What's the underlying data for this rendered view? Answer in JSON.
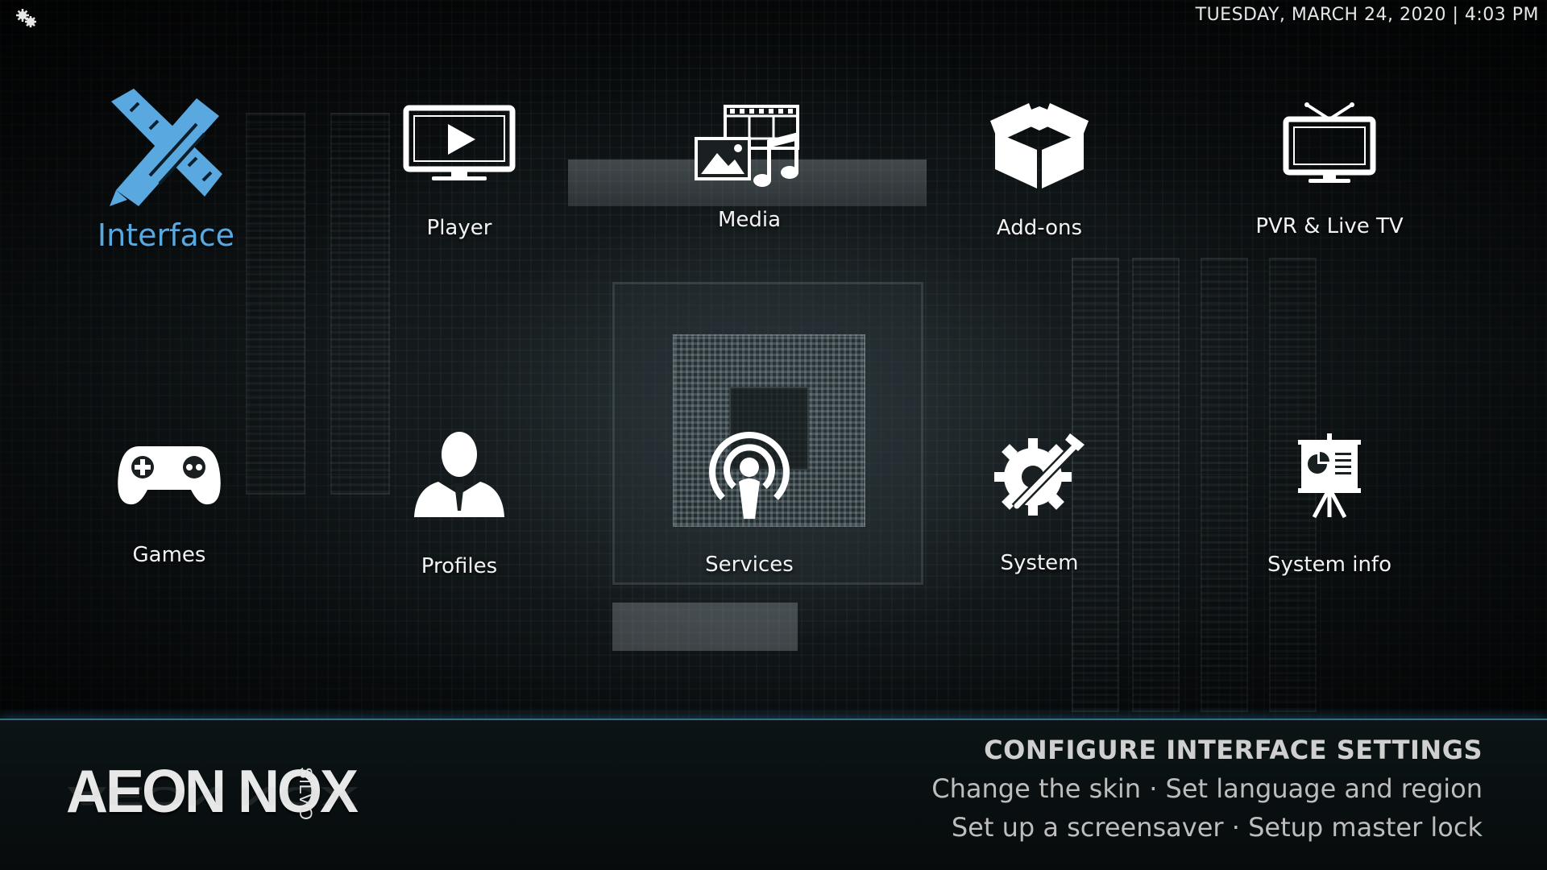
{
  "topbar": {
    "datetime": "TUESDAY, MARCH 24, 2020 | 4:03 PM",
    "settings_icon": "settings-cogs-icon"
  },
  "menu": {
    "focused": "interface",
    "items": [
      {
        "id": "interface",
        "label": "Interface",
        "icon": "pencil-ruler-icon"
      },
      {
        "id": "player",
        "label": "Player",
        "icon": "monitor-play-icon"
      },
      {
        "id": "media",
        "label": "Media",
        "icon": "media-collage-icon"
      },
      {
        "id": "addons",
        "label": "Add-ons",
        "icon": "open-box-icon"
      },
      {
        "id": "pvr",
        "label": "PVR & Live TV",
        "icon": "tv-antenna-icon"
      },
      {
        "id": "games",
        "label": "Games",
        "icon": "gamepad-icon"
      },
      {
        "id": "profiles",
        "label": "Profiles",
        "icon": "person-icon"
      },
      {
        "id": "services",
        "label": "Services",
        "icon": "podcast-icon"
      },
      {
        "id": "system",
        "label": "System",
        "icon": "gear-wrench-icon"
      },
      {
        "id": "sysinfo",
        "label": "System info",
        "icon": "presentation-easel-icon"
      }
    ]
  },
  "footer": {
    "logo_main": "AEON NOX",
    "logo_sub": "SiLVO",
    "info_title": "CONFIGURE INTERFACE SETTINGS",
    "info_lines": [
      "Change the skin · Set language and region",
      "Set up a screensaver · Setup master lock"
    ]
  },
  "colors": {
    "accent": "#5aa8e0",
    "label": "#f2f2f2",
    "footer_border": "#3a6d86"
  }
}
